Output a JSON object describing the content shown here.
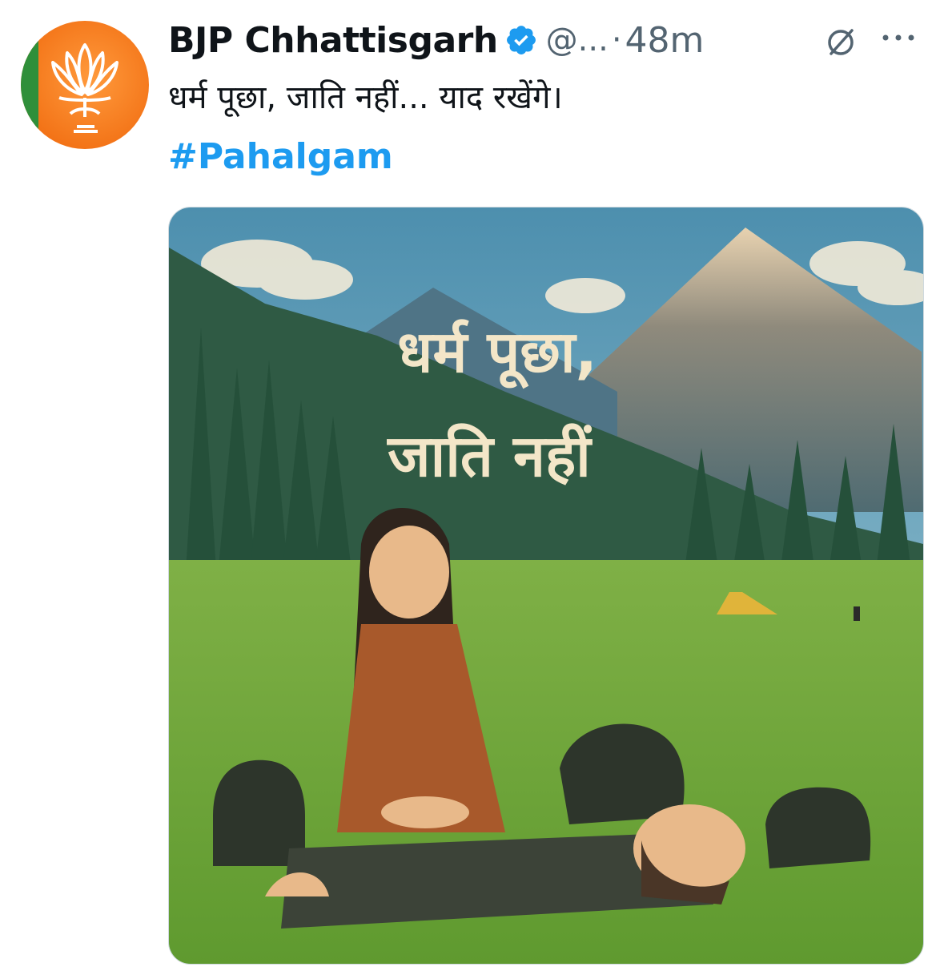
{
  "tweet": {
    "author_name": "BJP Chhattisgarh",
    "handle": "@...",
    "separator": "·",
    "time": "48m",
    "text": "धर्म पूछा, जाति नहीं... याद रखेंगे।",
    "hashtag": "#Pahalgam"
  },
  "image": {
    "line1": "धर्म पूछा,",
    "line2": "जाति नहीं"
  },
  "icons": {
    "avatar": "lotus-logo",
    "verified": "verified-badge-icon",
    "grok": "grok-icon",
    "more": "more-icon"
  },
  "colors": {
    "hashtag": "#1d9bf0",
    "verified": "#1d9bf0",
    "avatar_orange": "#f47a1f",
    "avatar_green": "#2f8f3a"
  }
}
